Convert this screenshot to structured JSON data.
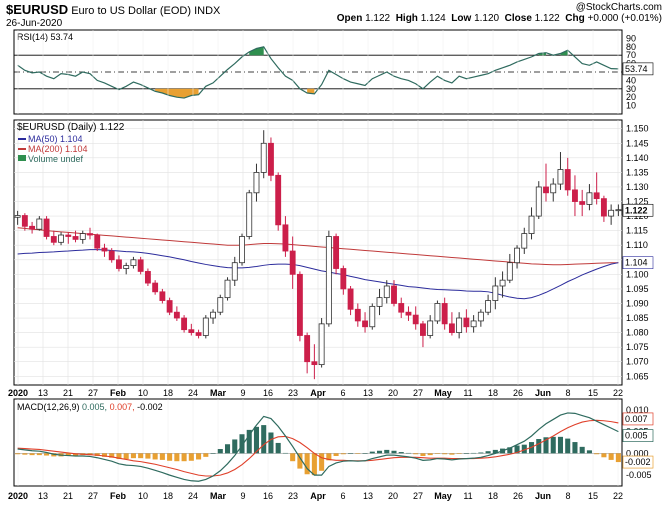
{
  "header": {
    "symbol": "$EURUSD",
    "description": "Euro to US Dollar (EOD)",
    "exchange": "INDX",
    "date": "26-Jun-2020",
    "open_label": "Open",
    "open": "1.122",
    "high_label": "High",
    "high": "1.124",
    "low_label": "Low",
    "low": "1.120",
    "close_label": "Close",
    "close": "1.122",
    "chg_label": "Chg",
    "chg": "+0.000 (+0.01%)",
    "copyright": "@StockCharts.com"
  },
  "colors": {
    "up": "#333333",
    "down": "#cc1f4a",
    "ma50": "#2c2c9c",
    "ma200": "#c03a3a",
    "rsi_line": "#2f6b5f",
    "macd_line": "#2f6b5f",
    "signal_line": "#e0402a",
    "hist_pos": "#2f6b5f",
    "hist_neg": "#e8a032",
    "rsi_fill_high": "#2f8f4f",
    "rsi_fill_low": "#e8a032"
  },
  "legends": {
    "rsi": "RSI(14) 53.74",
    "price": "$EURUSD (Daily) 1.122",
    "ma50": "MA(50) 1.104",
    "ma200": "MA(200) 1.104",
    "volume": "Volume undef",
    "macd_prefix": "MACD(12,26,9)",
    "macd_v1": "0.005,",
    "macd_v2": "0.007,",
    "macd_v3": "-0.002"
  },
  "x_axis_labels": [
    "2020",
    "13",
    "21",
    "27",
    "Feb",
    "10",
    "18",
    "24",
    "Mar",
    "9",
    "16",
    "23",
    "Apr",
    "6",
    "13",
    "20",
    "27",
    "May",
    "11",
    "18",
    "26",
    "Jun",
    "8",
    "15",
    "22"
  ],
  "price_axis": {
    "ticks": [
      "1.065",
      "1.070",
      "1.075",
      "1.080",
      "1.085",
      "1.090",
      "1.095",
      "1.100",
      "1.105",
      "1.110",
      "1.115",
      "1.120",
      "1.125",
      "1.130",
      "1.135",
      "1.140",
      "1.145",
      "1.150"
    ],
    "ylim": [
      1.062,
      1.153
    ],
    "tag_close": "1.122",
    "tag_ma": "1.104"
  },
  "rsi_axis": {
    "ticks": [
      "90",
      "80",
      "70",
      "60",
      "50",
      "40",
      "30",
      "20",
      "10"
    ],
    "tag": "53.74"
  },
  "macd_axis": {
    "ticks": [
      "0.010",
      "0.005",
      "0.000",
      "-0.005"
    ],
    "tags": [
      "0.007",
      "0.005",
      "-0.002"
    ]
  },
  "chart_data": {
    "type": "candlestick",
    "title": "$EURUSD (Daily) 1.122",
    "candles": [
      [
        1.1196,
        1.1218,
        1.117,
        1.1202
      ],
      [
        1.1202,
        1.121,
        1.115,
        1.1165
      ],
      [
        1.1165,
        1.118,
        1.114,
        1.1155
      ],
      [
        1.1155,
        1.12,
        1.115,
        1.119
      ],
      [
        1.119,
        1.12,
        1.112,
        1.113
      ],
      [
        1.113,
        1.115,
        1.11,
        1.111
      ],
      [
        1.111,
        1.1145,
        1.11,
        1.1135
      ],
      [
        1.1135,
        1.1145,
        1.1105,
        1.113
      ],
      [
        1.113,
        1.115,
        1.111,
        1.112
      ],
      [
        1.112,
        1.115,
        1.1105,
        1.114
      ],
      [
        1.114,
        1.116,
        1.112,
        1.1135
      ],
      [
        1.1135,
        1.114,
        1.108,
        1.109
      ],
      [
        1.109,
        1.1105,
        1.106,
        1.108
      ],
      [
        1.108,
        1.109,
        1.104,
        1.105
      ],
      [
        1.105,
        1.1065,
        1.101,
        1.102
      ],
      [
        1.102,
        1.104,
        1.1,
        1.103
      ],
      [
        1.103,
        1.106,
        1.102,
        1.105
      ],
      [
        1.105,
        1.106,
        1.1,
        1.101
      ],
      [
        1.101,
        1.102,
        1.096,
        1.097
      ],
      [
        1.097,
        1.098,
        1.093,
        1.094
      ],
      [
        1.094,
        1.095,
        1.09,
        1.091
      ],
      [
        1.091,
        1.092,
        1.086,
        1.087
      ],
      [
        1.087,
        1.089,
        1.084,
        1.085
      ],
      [
        1.085,
        1.086,
        1.08,
        1.081
      ],
      [
        1.081,
        1.083,
        1.079,
        1.08
      ],
      [
        1.08,
        1.081,
        1.078,
        1.079
      ],
      [
        1.079,
        1.086,
        1.078,
        1.085
      ],
      [
        1.085,
        1.088,
        1.083,
        1.087
      ],
      [
        1.087,
        1.093,
        1.086,
        1.092
      ],
      [
        1.092,
        1.099,
        1.091,
        1.098
      ],
      [
        1.098,
        1.106,
        1.096,
        1.104
      ],
      [
        1.104,
        1.114,
        1.103,
        1.113
      ],
      [
        1.113,
        1.129,
        1.112,
        1.128
      ],
      [
        1.128,
        1.138,
        1.125,
        1.135
      ],
      [
        1.135,
        1.1495,
        1.133,
        1.145
      ],
      [
        1.145,
        1.147,
        1.132,
        1.134
      ],
      [
        1.134,
        1.135,
        1.115,
        1.117
      ],
      [
        1.117,
        1.12,
        1.106,
        1.108
      ],
      [
        1.108,
        1.113,
        1.095,
        1.1
      ],
      [
        1.1,
        1.101,
        1.077,
        1.079
      ],
      [
        1.079,
        1.08,
        1.066,
        1.07
      ],
      [
        1.07,
        1.076,
        1.064,
        1.069
      ],
      [
        1.069,
        1.085,
        1.068,
        1.083
      ],
      [
        1.083,
        1.115,
        1.082,
        1.113
      ],
      [
        1.113,
        1.114,
        1.1,
        1.102
      ],
      [
        1.102,
        1.103,
        1.093,
        1.095
      ],
      [
        1.095,
        1.096,
        1.086,
        1.088
      ],
      [
        1.088,
        1.09,
        1.082,
        1.084
      ],
      [
        1.084,
        1.087,
        1.08,
        1.082
      ],
      [
        1.082,
        1.09,
        1.081,
        1.089
      ],
      [
        1.089,
        1.095,
        1.086,
        1.092
      ],
      [
        1.092,
        1.098,
        1.09,
        1.096
      ],
      [
        1.096,
        1.098,
        1.089,
        1.09
      ],
      [
        1.09,
        1.092,
        1.085,
        1.087
      ],
      [
        1.087,
        1.089,
        1.084,
        1.086
      ],
      [
        1.086,
        1.089,
        1.081,
        1.083
      ],
      [
        1.083,
        1.084,
        1.075,
        1.079
      ],
      [
        1.079,
        1.086,
        1.078,
        1.084
      ],
      [
        1.084,
        1.091,
        1.083,
        1.09
      ],
      [
        1.09,
        1.092,
        1.081,
        1.083
      ],
      [
        1.083,
        1.087,
        1.079,
        1.08
      ],
      [
        1.08,
        1.087,
        1.078,
        1.085
      ],
      [
        1.085,
        1.088,
        1.08,
        1.082
      ],
      [
        1.082,
        1.086,
        1.08,
        1.084
      ],
      [
        1.084,
        1.088,
        1.082,
        1.087
      ],
      [
        1.087,
        1.093,
        1.086,
        1.091
      ],
      [
        1.091,
        1.099,
        1.088,
        1.096
      ],
      [
        1.096,
        1.101,
        1.092,
        1.098
      ],
      [
        1.098,
        1.107,
        1.097,
        1.104
      ],
      [
        1.104,
        1.11,
        1.102,
        1.109
      ],
      [
        1.109,
        1.116,
        1.107,
        1.114
      ],
      [
        1.114,
        1.123,
        1.112,
        1.12
      ],
      [
        1.12,
        1.132,
        1.119,
        1.13
      ],
      [
        1.13,
        1.138,
        1.125,
        1.128
      ],
      [
        1.128,
        1.133,
        1.125,
        1.131
      ],
      [
        1.131,
        1.142,
        1.129,
        1.136
      ],
      [
        1.136,
        1.14,
        1.127,
        1.129
      ],
      [
        1.129,
        1.134,
        1.12,
        1.125
      ],
      [
        1.125,
        1.129,
        1.12,
        1.124
      ],
      [
        1.124,
        1.131,
        1.122,
        1.128
      ],
      [
        1.128,
        1.135,
        1.124,
        1.126
      ],
      [
        1.126,
        1.127,
        1.118,
        1.12
      ],
      [
        1.12,
        1.124,
        1.117,
        1.122
      ],
      [
        1.122,
        1.124,
        1.12,
        1.1222
      ]
    ],
    "ma50": [
      1.107,
      1.1072,
      1.1073,
      1.1075,
      1.1076,
      1.1077,
      1.1079,
      1.108,
      1.1082,
      1.1083,
      1.1085,
      1.1085,
      1.1084,
      1.1082,
      1.108,
      1.1078,
      1.1077,
      1.1075,
      1.1072,
      1.1068,
      1.1064,
      1.106,
      1.1055,
      1.105,
      1.1044,
      1.1039,
      1.1034,
      1.103,
      1.1026,
      1.1023,
      1.1022,
      1.1022,
      1.1024,
      1.1027,
      1.1031,
      1.1034,
      1.1035,
      1.1035,
      1.1034,
      1.103,
      1.1024,
      1.1018,
      1.1012,
      1.1008,
      1.1003,
      1.0999,
      1.0993,
      1.0988,
      1.0982,
      1.0978,
      1.0974,
      1.097,
      1.0966,
      1.0962,
      1.0958,
      1.0956,
      1.0953,
      1.095,
      1.0948,
      1.0947,
      1.0946,
      1.0945,
      1.0943,
      1.0942,
      1.0942,
      1.094,
      1.0935,
      1.0928,
      1.0922,
      1.0918,
      1.0916,
      1.092,
      1.0928,
      1.0938,
      1.095,
      1.0962,
      1.0975,
      1.0986,
      1.0998,
      1.1008,
      1.1018,
      1.1027,
      1.1035,
      1.104
    ],
    "ma200": [
      1.116,
      1.1158,
      1.1155,
      1.1153,
      1.115,
      1.1148,
      1.1146,
      1.1144,
      1.1142,
      1.114,
      1.1138,
      1.1136,
      1.1134,
      1.1132,
      1.113,
      1.1128,
      1.1126,
      1.1124,
      1.1122,
      1.112,
      1.1118,
      1.1116,
      1.1114,
      1.1112,
      1.111,
      1.1108,
      1.1106,
      1.1104,
      1.1102,
      1.11,
      1.11,
      1.11,
      1.1102,
      1.1104,
      1.1106,
      1.1106,
      1.1105,
      1.1104,
      1.1102,
      1.11,
      1.1098,
      1.1096,
      1.1094,
      1.1092,
      1.109,
      1.1088,
      1.1086,
      1.1084,
      1.1082,
      1.108,
      1.1078,
      1.1076,
      1.1074,
      1.1072,
      1.107,
      1.1068,
      1.1066,
      1.1064,
      1.1062,
      1.106,
      1.1058,
      1.1056,
      1.1054,
      1.1052,
      1.105,
      1.1048,
      1.1046,
      1.1044,
      1.1042,
      1.104,
      1.1038,
      1.1036,
      1.1035,
      1.1034,
      1.1033,
      1.1033,
      1.1034,
      1.1035,
      1.1036,
      1.1037,
      1.1038,
      1.1039,
      1.104,
      1.104
    ],
    "rsi": [
      58,
      52,
      49,
      50,
      45,
      42,
      48,
      47,
      45,
      50,
      48,
      40,
      37,
      33,
      29,
      33,
      38,
      35,
      31,
      27,
      25,
      22,
      20,
      19,
      22,
      23,
      33,
      37,
      45,
      53,
      60,
      68,
      74,
      78,
      80,
      66,
      55,
      45,
      40,
      30,
      25,
      24,
      35,
      52,
      47,
      42,
      38,
      36,
      34,
      42,
      46,
      50,
      45,
      42,
      40,
      36,
      30,
      38,
      45,
      40,
      37,
      45,
      42,
      44,
      46,
      48,
      52,
      55,
      58,
      62,
      65,
      68,
      72,
      73,
      70,
      72,
      76,
      68,
      60,
      58,
      62,
      58,
      54,
      53.74
    ],
    "rsi_ylim": [
      0,
      100
    ],
    "macd": [
      0.001,
      0.0008,
      0.0006,
      0.0005,
      0.0002,
      -0.0002,
      -0.0004,
      -0.0005,
      -0.0006,
      -0.0006,
      -0.0007,
      -0.001,
      -0.0014,
      -0.0018,
      -0.0024,
      -0.0027,
      -0.0028,
      -0.003,
      -0.0034,
      -0.0039,
      -0.0044,
      -0.005,
      -0.0055,
      -0.006,
      -0.0063,
      -0.0064,
      -0.006,
      -0.0052,
      -0.004,
      -0.0024,
      -0.0005,
      0.0018,
      0.0042,
      0.0065,
      0.0085,
      0.008,
      0.0062,
      0.004,
      0.0016,
      -0.001,
      -0.0035,
      -0.005,
      -0.005,
      -0.003,
      -0.0022,
      -0.0018,
      -0.0017,
      -0.0018,
      -0.0017,
      -0.0012,
      -0.0008,
      -0.0004,
      -0.0004,
      -0.0006,
      -0.0008,
      -0.0011,
      -0.0016,
      -0.0015,
      -0.0012,
      -0.0013,
      -0.0015,
      -0.0013,
      -0.0012,
      -0.0011,
      -0.0009,
      -0.0005,
      0.0,
      0.0006,
      0.0012,
      0.002,
      0.0028,
      0.004,
      0.0055,
      0.0068,
      0.0078,
      0.0088,
      0.0093,
      0.0092,
      0.0087,
      0.0082,
      0.0074,
      0.0066,
      0.0058,
      0.005
    ],
    "signal": [
      0.0012,
      0.0011,
      0.001,
      0.0009,
      0.0007,
      0.0005,
      0.0003,
      0.0001,
      -0.0001,
      -0.0002,
      -0.0003,
      -0.0004,
      -0.0006,
      -0.0008,
      -0.0011,
      -0.0014,
      -0.0017,
      -0.0019,
      -0.0022,
      -0.0025,
      -0.0029,
      -0.0033,
      -0.0037,
      -0.0042,
      -0.0046,
      -0.005,
      -0.0052,
      -0.0052,
      -0.005,
      -0.0045,
      -0.0037,
      -0.0026,
      -0.0012,
      0.0004,
      0.002,
      0.0032,
      0.0038,
      0.0039,
      0.0034,
      0.0025,
      0.0013,
      0.0,
      -0.001,
      -0.0014,
      -0.0016,
      -0.0016,
      -0.0017,
      -0.0017,
      -0.0017,
      -0.0016,
      -0.0014,
      -0.0012,
      -0.001,
      -0.0009,
      -0.0009,
      -0.0009,
      -0.001,
      -0.0011,
      -0.0011,
      -0.0011,
      -0.0012,
      -0.0012,
      -0.0012,
      -0.0012,
      -0.0011,
      -0.001,
      -0.0008,
      -0.0005,
      -0.0002,
      0.0002,
      0.0008,
      0.0014,
      0.0022,
      0.0031,
      0.004,
      0.005,
      0.0059,
      0.0066,
      0.0072,
      0.0075,
      0.0076,
      0.0075,
      0.0073,
      0.007
    ],
    "macd_ylim": [
      -0.0075,
      0.0125
    ],
    "ylim": [
      1.062,
      1.153
    ]
  }
}
